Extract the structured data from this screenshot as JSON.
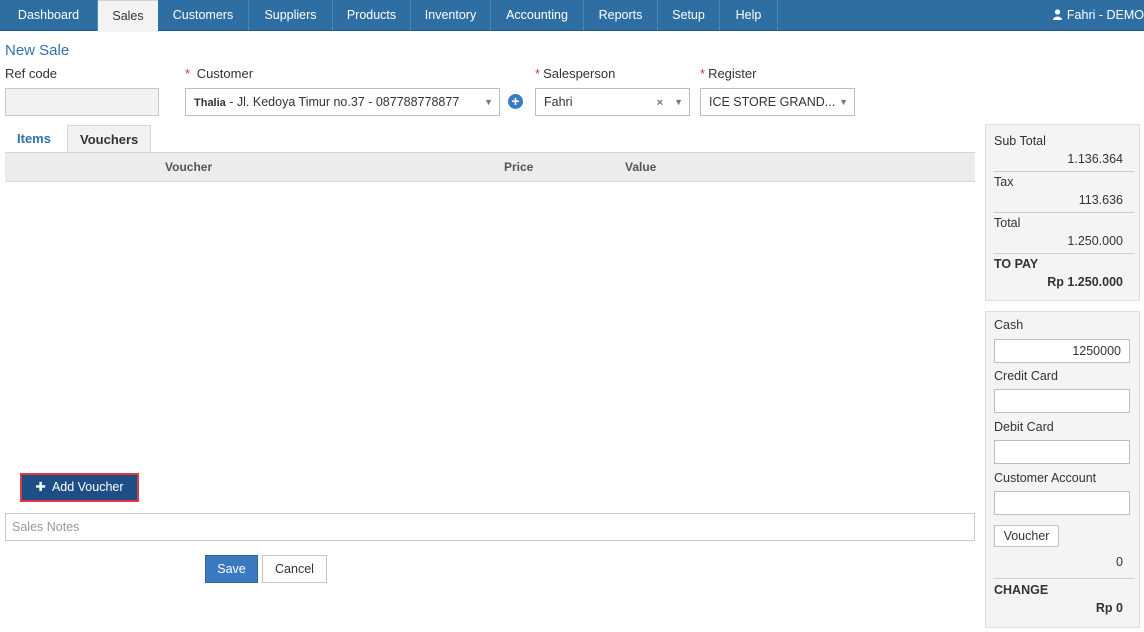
{
  "nav": {
    "tabs": [
      "Dashboard",
      "Sales",
      "Customers",
      "Suppliers",
      "Products",
      "Inventory",
      "Accounting",
      "Reports",
      "Setup",
      "Help"
    ],
    "active_tab": "Sales",
    "user": "Fahri - DEMO",
    "user_icon": "user-icon"
  },
  "page": {
    "title": "New Sale"
  },
  "form": {
    "ref_code_label": "Ref code",
    "ref_code_value": "",
    "customer_label": "Customer",
    "customer_name": "Thalia",
    "customer_detail": " - Jl. Kedoya Timur no.37 - 087788778877",
    "salesperson_label": "Salesperson",
    "salesperson_value": "Fahri",
    "register_label": "Register",
    "register_value": "ICE STORE GRAND...",
    "required_mark": "*"
  },
  "subtabs": [
    "Items",
    "Vouchers"
  ],
  "active_subtab": "Vouchers",
  "table": {
    "columns": [
      "Voucher",
      "Price",
      "Value"
    ],
    "rows": []
  },
  "buttons": {
    "add_voucher": "Add Voucher",
    "save": "Save",
    "cancel": "Cancel",
    "voucher": "Voucher"
  },
  "notes": {
    "placeholder": "Sales Notes"
  },
  "summary": {
    "sub_total_label": "Sub Total",
    "sub_total": "1.136.364",
    "tax_label": "Tax",
    "tax": "113.636",
    "total_label": "Total",
    "total": "1.250.000",
    "to_pay_label": "TO PAY",
    "to_pay": "Rp 1.250.000"
  },
  "payment": {
    "cash_label": "Cash",
    "cash": "1250000",
    "credit_label": "Credit Card",
    "credit": "",
    "debit_label": "Debit Card",
    "debit": "",
    "account_label": "Customer Account",
    "account": "",
    "voucher_value": "0",
    "change_label": "CHANGE",
    "change": "Rp 0"
  },
  "colors": {
    "nav_bg": "#2f6ea3",
    "primary": "#3b7ac0",
    "add_voucher_bg": "#1d4f86",
    "highlight": "#e0383c"
  }
}
